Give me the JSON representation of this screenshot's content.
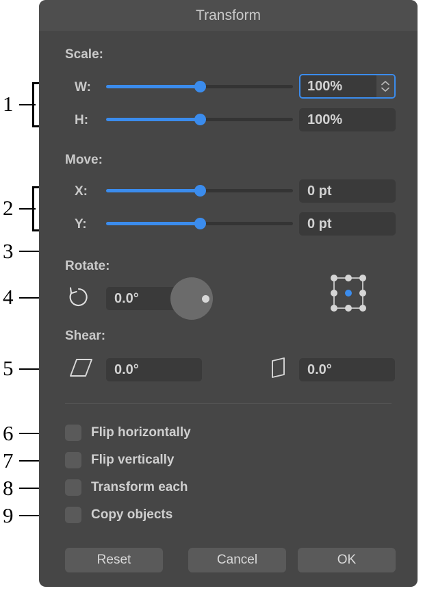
{
  "dialog": {
    "title": "Transform",
    "groups": {
      "scale": "Scale:",
      "move": "Move:",
      "rotate": "Rotate:",
      "shear": "Shear:"
    },
    "rows": [
      {
        "label": "W:",
        "value": "100%",
        "slider_percent": 50,
        "focused": true,
        "has_stepper": true
      },
      {
        "label": "H:",
        "value": "100%",
        "slider_percent": 50,
        "focused": false,
        "has_stepper": false
      },
      {
        "label": "X:",
        "value": "0 pt",
        "slider_percent": 50,
        "focused": false,
        "has_stepper": false
      },
      {
        "label": "Y:",
        "value": "0 pt",
        "slider_percent": 50,
        "focused": false,
        "has_stepper": false
      }
    ],
    "rotate": {
      "icon": "rotate-counterclockwise-icon",
      "value": "0.0°",
      "dial_angle_degrees": 0
    },
    "anchor_grid": {
      "name": "reference-point-grid",
      "selected": "center"
    },
    "shear": {
      "horizontal": {
        "icon": "shear-horizontal-icon",
        "value": "0.0°"
      },
      "vertical": {
        "icon": "shear-vertical-icon",
        "value": "0.0°"
      }
    },
    "checkboxes": [
      {
        "label": "Flip horizontally",
        "checked": false
      },
      {
        "label": "Flip vertically",
        "checked": false
      },
      {
        "label": "Transform each",
        "checked": false
      },
      {
        "label": "Copy objects",
        "checked": false
      }
    ],
    "buttons": {
      "reset": "Reset",
      "cancel": "Cancel",
      "ok": "OK"
    }
  },
  "callouts": [
    {
      "number": "1",
      "targets": "scale-rows"
    },
    {
      "number": "2",
      "targets": "move-rows"
    },
    {
      "number": "3",
      "targets": "reference-point-grid"
    },
    {
      "number": "4",
      "targets": "rotate-row"
    },
    {
      "number": "5",
      "targets": "shear-row"
    },
    {
      "number": "6",
      "targets": "flip-horizontally"
    },
    {
      "number": "7",
      "targets": "flip-vertically"
    },
    {
      "number": "8",
      "targets": "transform-each"
    },
    {
      "number": "9",
      "targets": "copy-objects"
    }
  ],
  "colors": {
    "accent": "#3b8ced",
    "dialog_bg": "#464646",
    "titlebar_bg": "#4e4e4e",
    "field_bg": "#3a3a3a",
    "text": "#c9c9c9"
  }
}
